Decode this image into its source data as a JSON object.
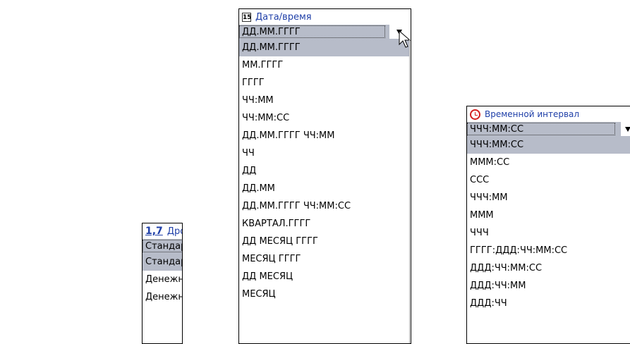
{
  "fractional": {
    "icon": "1,7",
    "title": "Дробное",
    "selected": "Стандартный",
    "options": [
      "Стандартный",
      "Денежный",
      "Денежный прописью"
    ]
  },
  "datetime": {
    "icon": "15",
    "title": "Дата/время",
    "selected": "ДД.ММ.ГГГГ",
    "options": [
      "ДД.ММ.ГГГГ",
      "ММ.ГГГГ",
      "ГГГГ",
      "ЧЧ:ММ",
      "ЧЧ:ММ:СС",
      "ДД.ММ.ГГГГ ЧЧ:ММ",
      "ЧЧ",
      "ДД",
      "ДД.ММ",
      "ДД.ММ.ГГГГ ЧЧ:ММ:СС",
      "КВАРТАЛ.ГГГГ",
      "ДД МЕСЯЦ ГГГГ",
      "МЕСЯЦ ГГГГ",
      "ДД МЕСЯЦ",
      "МЕСЯЦ"
    ]
  },
  "interval": {
    "icon": "clock-icon",
    "title": "Временной интервал",
    "selected": "ЧЧЧ:ММ:СС",
    "options": [
      "ЧЧЧ:ММ:СС",
      "МММ:СС",
      "ССС",
      "ЧЧЧ:ММ",
      "МММ",
      "ЧЧЧ",
      "ГГГГ:ДДД:ЧЧ:ММ:СС",
      "ДДД:ЧЧ:ММ:СС",
      "ДДД:ЧЧ:ММ",
      "ДДД:ЧЧ"
    ]
  }
}
